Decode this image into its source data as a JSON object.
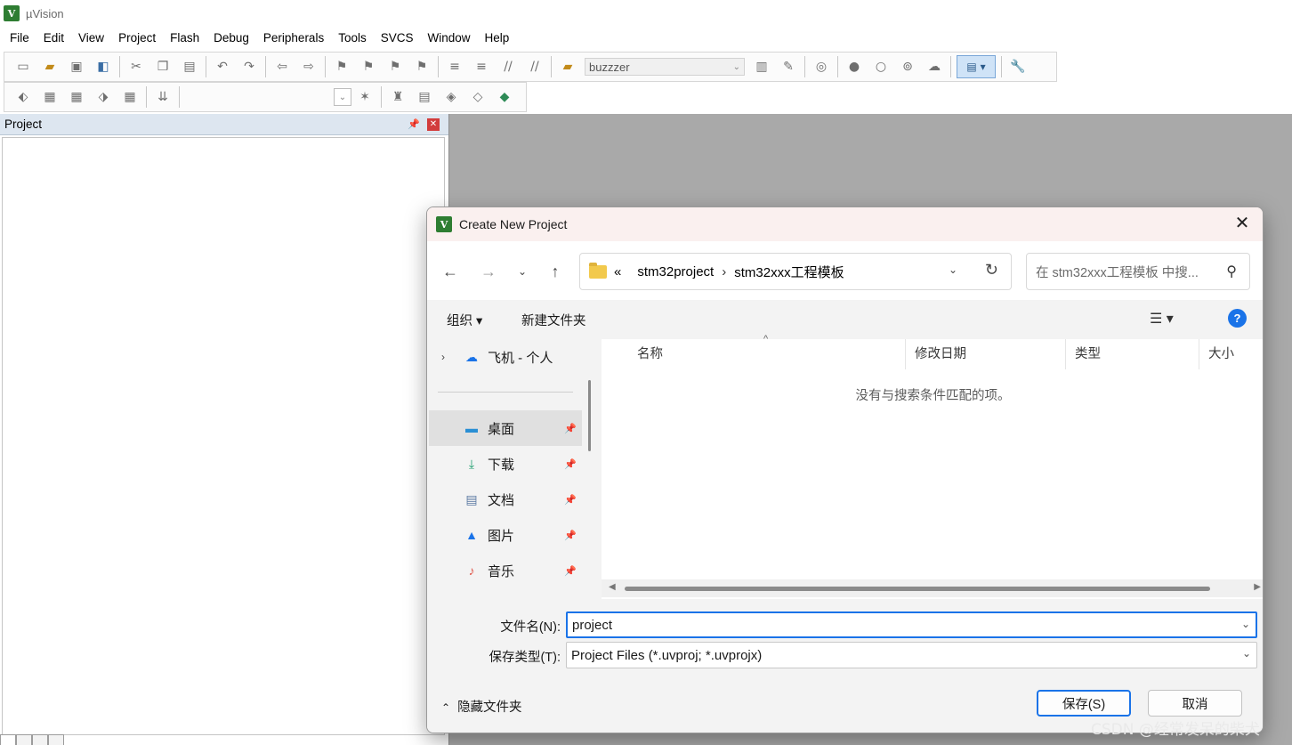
{
  "app": {
    "title": "µVision",
    "logo": "keil-logo"
  },
  "menu": [
    "File",
    "Edit",
    "View",
    "Project",
    "Flash",
    "Debug",
    "Peripherals",
    "Tools",
    "SVCS",
    "Window",
    "Help"
  ],
  "toolbar": {
    "target_name": "buzzzer"
  },
  "project_pane": {
    "title": "Project"
  },
  "dialog": {
    "title": "Create New Project",
    "close_glyph": "✕",
    "breadcrumb": {
      "overflow": "«",
      "parts": [
        "stm32project",
        "stm32xxx工程模板"
      ]
    },
    "search_placeholder": "在 stm32xxx工程模板 中搜...",
    "commands": {
      "organize": "组织 ▾",
      "new_folder": "新建文件夹"
    },
    "nav_items": [
      {
        "label": "飞机 - 个人",
        "icon": "onedrive-cloud-icon"
      },
      {
        "label": "桌面",
        "icon": "desktop-icon"
      },
      {
        "label": "下载",
        "icon": "download-icon"
      },
      {
        "label": "文档",
        "icon": "documents-icon"
      },
      {
        "label": "图片",
        "icon": "pictures-icon"
      },
      {
        "label": "音乐",
        "icon": "music-icon"
      }
    ],
    "columns": [
      "名称",
      "修改日期",
      "类型",
      "大小"
    ],
    "empty_message": "没有与搜索条件匹配的项。",
    "filename_label": "文件名(N):",
    "filename_value": "project",
    "savetype_label": "保存类型(T):",
    "savetype_value": "Project Files (*.uvproj; *.uvprojx)",
    "hide_folders": "隐藏文件夹",
    "save_button": "保存(S)",
    "cancel_button": "取消"
  },
  "watermark": "CSDN @经常发呆的柴犬",
  "colors": {
    "accent": "#1a73e8",
    "workspace": "#a9a9a9",
    "logo_green": "#2e7d32"
  }
}
